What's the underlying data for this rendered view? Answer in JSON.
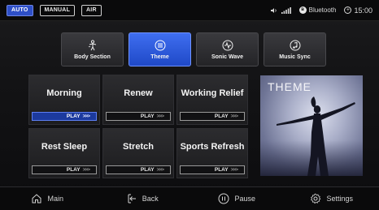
{
  "status_bar": {
    "modes": [
      {
        "label": "AUTO",
        "active": true
      },
      {
        "label": "MANUAL",
        "active": false
      },
      {
        "label": "AIR",
        "active": false
      }
    ],
    "bluetooth_label": "Bluetooth",
    "time": "15:00"
  },
  "tabs": [
    {
      "label": "Body Section",
      "icon": "body-icon",
      "selected": false
    },
    {
      "label": "Theme",
      "icon": "theme-icon",
      "selected": true
    },
    {
      "label": "Sonic Wave",
      "icon": "sonic-wave-icon",
      "selected": false
    },
    {
      "label": "Music Sync",
      "icon": "music-sync-icon",
      "selected": false
    }
  ],
  "programs": [
    {
      "title": "Morning",
      "play_label": "PLAY",
      "active": true
    },
    {
      "title": "Renew",
      "play_label": "PLAY",
      "active": false
    },
    {
      "title": "Working Relief",
      "play_label": "PLAY",
      "active": false
    },
    {
      "title": "Rest Sleep",
      "play_label": "PLAY",
      "active": false
    },
    {
      "title": "Stretch",
      "play_label": "PLAY",
      "active": false
    },
    {
      "title": "Sports Refresh",
      "play_label": "PLAY",
      "active": false
    }
  ],
  "play_chevrons": ">>>",
  "theme_panel": {
    "title": "THEME"
  },
  "bottom_nav": [
    {
      "label": "Main",
      "icon": "home-icon"
    },
    {
      "label": "Back",
      "icon": "back-icon"
    },
    {
      "label": "Pause",
      "icon": "pause-icon"
    },
    {
      "label": "Settings",
      "icon": "gear-icon"
    }
  ],
  "colors": {
    "accent": "#2e4fc7",
    "tab_selected": "#3f6ef0",
    "play_active": "#1c3a9e"
  }
}
